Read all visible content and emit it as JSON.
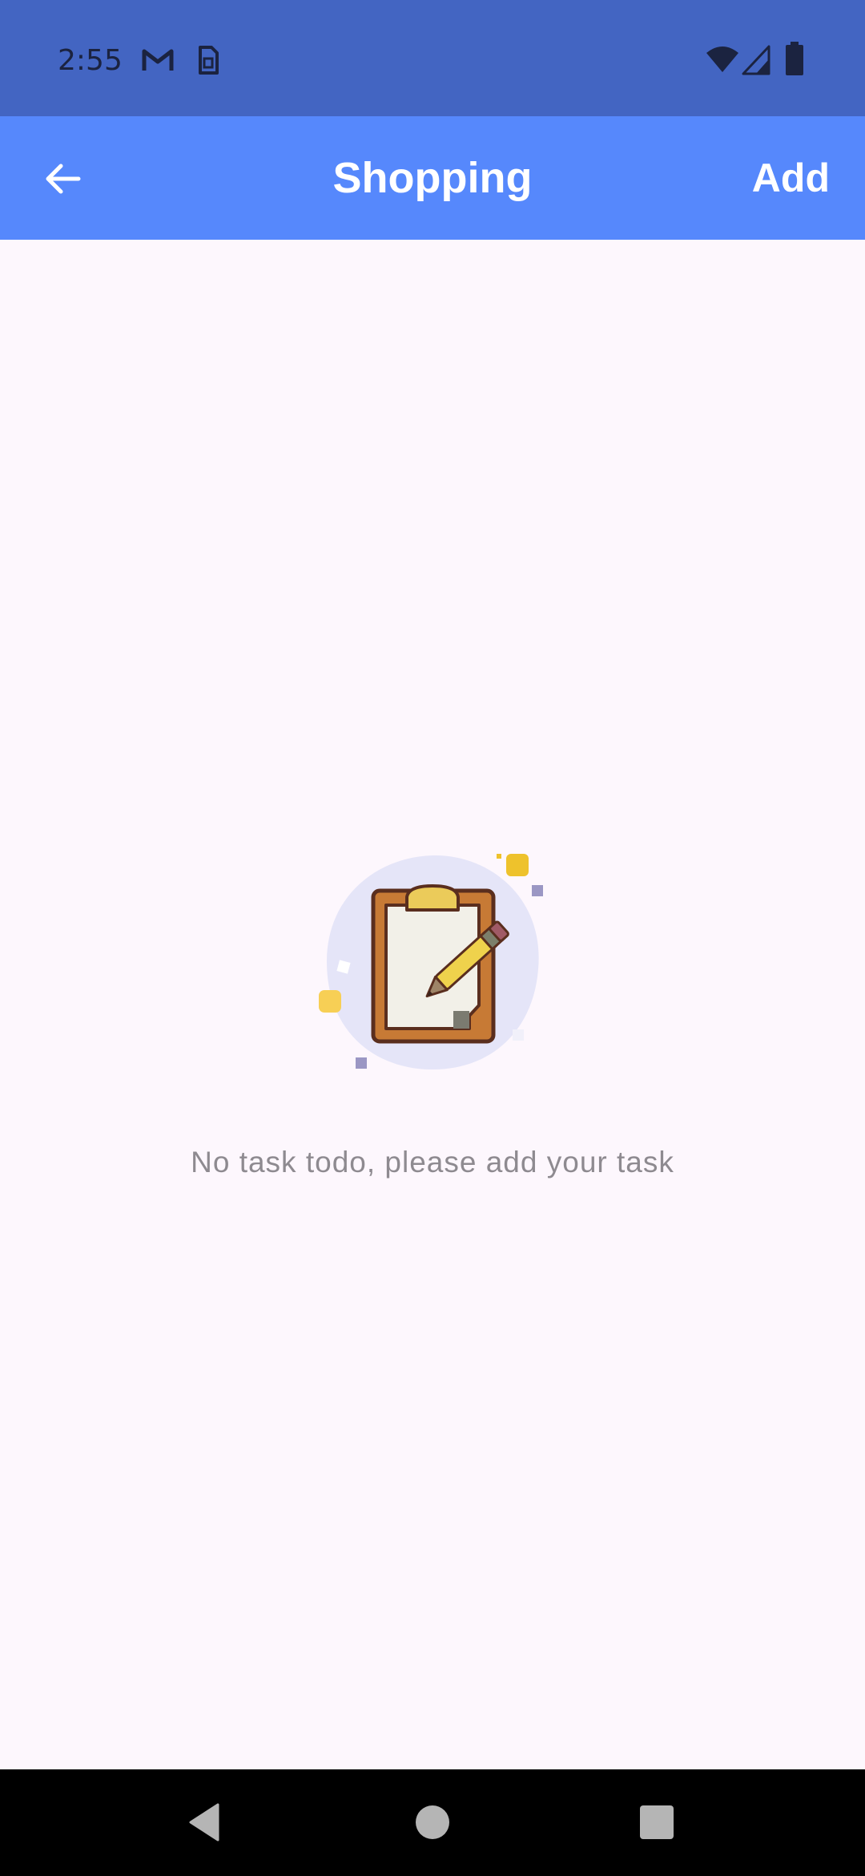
{
  "status_bar": {
    "time": "2:55",
    "left_icons": [
      "gmail-icon",
      "sim-icon"
    ],
    "right_icons": [
      "wifi-icon",
      "signal-icon",
      "battery-icon"
    ],
    "background": "#4365C2"
  },
  "app_bar": {
    "title": "Shopping",
    "back_icon": "arrow-left-icon",
    "action_label": "Add",
    "background": "#5688FC"
  },
  "empty_state": {
    "illustration": "clipboard-pencil-icon",
    "message": "No task todo, please add your task"
  },
  "nav_bar": {
    "buttons": [
      "back-triangle-icon",
      "home-circle-icon",
      "recents-square-icon"
    ]
  }
}
